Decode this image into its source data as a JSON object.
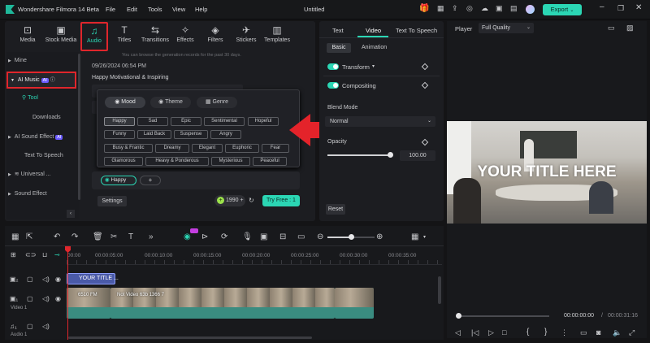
{
  "app": {
    "title": "Wondershare Filmora 14 Beta",
    "project": "Untitled"
  },
  "menu": [
    "File",
    "Edit",
    "Tools",
    "View",
    "Help"
  ],
  "export_label": "Export",
  "media_tabs": [
    {
      "label": "Media",
      "icon": "media-icon"
    },
    {
      "label": "Stock Media",
      "icon": "stock-media-icon"
    },
    {
      "label": "Audio",
      "icon": "music-note-icon"
    },
    {
      "label": "Titles",
      "icon": "text-icon"
    },
    {
      "label": "Transitions",
      "icon": "transitions-icon"
    },
    {
      "label": "Effects",
      "icon": "effects-icon"
    },
    {
      "label": "Filters",
      "icon": "filters-icon"
    },
    {
      "label": "Stickers",
      "icon": "stickers-icon"
    },
    {
      "label": "Templates",
      "icon": "templates-icon"
    }
  ],
  "sidebar": {
    "items": [
      {
        "label": "Mine"
      },
      {
        "label": "AI Music",
        "badge": "AI"
      },
      {
        "label": "Tool"
      },
      {
        "label": "Downloads"
      },
      {
        "label": "AI Sound Effect",
        "badge": "AI"
      },
      {
        "label": "Text To Speech"
      },
      {
        "label": "Universal ..."
      },
      {
        "label": "Sound Effect"
      }
    ]
  },
  "music": {
    "hint": "You can browse the generation records for the past 30 days.",
    "date": "09/26/2024 06:54 PM",
    "track_title": "Happy Motivational & Inspiring"
  },
  "mood_popup": {
    "tabs": [
      "Mood",
      "Theme",
      "Genre"
    ],
    "tags": [
      [
        "Happy",
        "Sad",
        "Epic",
        "Sentimental",
        "Hopeful"
      ],
      [
        "Funny",
        "Laid Back",
        "Suspense",
        "Angry"
      ],
      [
        "Busy & Frantic",
        "Dreamy",
        "Elegant",
        "Euphoric",
        "Fear"
      ],
      [
        "Glamorous",
        "Heavy & Ponderous",
        "Mysterious",
        "Peaceful"
      ]
    ]
  },
  "selected_tag": "Happy",
  "add_symbol": "+",
  "settings_label": "Settings",
  "credits": "1990",
  "try_free": "Try Free : 1",
  "right_panel": {
    "tabs": [
      "Text",
      "Video",
      "Text To Speech"
    ],
    "subtabs": [
      "Basic",
      "Animation"
    ],
    "transform": "Transform",
    "compositing": "Compositing",
    "blend_mode_label": "Blend Mode",
    "blend_mode_value": "Normal",
    "opacity_label": "Opacity",
    "opacity_value": "100.00",
    "opacity_fraction": 1.0,
    "reset": "Reset"
  },
  "player": {
    "label": "Player",
    "quality": "Full Quality",
    "title_text": "YOUR TITLE HERE",
    "current_time": "00:00:00:00",
    "total_time": "00:00:31:16"
  },
  "timeline": {
    "ruler": [
      "00:00",
      "00:00:05:00",
      "00:00:10:00",
      "00:00:15:00",
      "00:00:20:00",
      "00:00:25:00",
      "00:00:30:00",
      "00:00:35:00"
    ],
    "title_clip": "YOUR TITLE ...",
    "video_label": "Video 1",
    "audio_label": "Audio 1",
    "video_clip_labels": [
      "6510 FM",
      "Not Video 63b 1366 7"
    ]
  },
  "colors": {
    "accent": "#2bd6b4",
    "highlight": "#e0262c",
    "clip": "#3a8c80",
    "title_clip": "#4a5aa8"
  }
}
